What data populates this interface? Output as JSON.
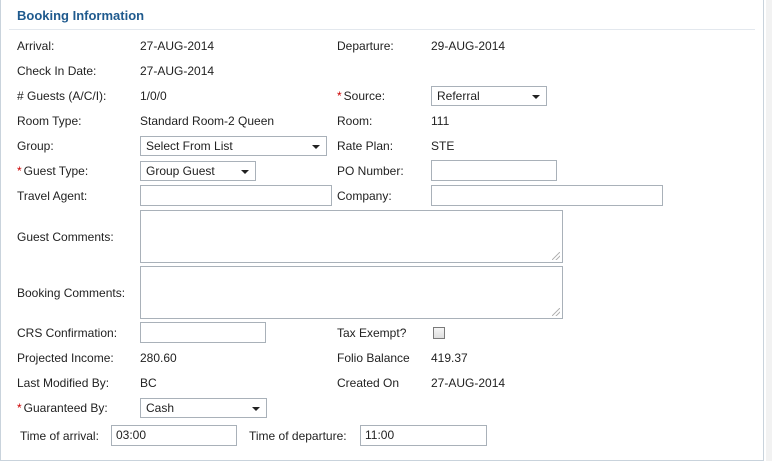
{
  "section": {
    "title": "Booking Information"
  },
  "row_arrival": {
    "arrival_label": "Arrival:",
    "arrival_value": "27-AUG-2014",
    "departure_label": "Departure:",
    "departure_value": "29-AUG-2014"
  },
  "row_checkin": {
    "label": "Check In Date:",
    "value": "27-AUG-2014"
  },
  "row_guests": {
    "label": "# Guests (A/C/I):",
    "value": "1/0/0",
    "source_label": "Source:",
    "source_value": "Referral"
  },
  "row_room": {
    "type_label": "Room Type:",
    "type_value": "Standard Room-2 Queen",
    "room_label": "Room:",
    "room_value": "111"
  },
  "row_group": {
    "label": "Group:",
    "value": "Select From List",
    "rate_label": "Rate Plan:",
    "rate_value": "STE"
  },
  "row_guesttype": {
    "label": "Guest Type:",
    "value": "Group Guest",
    "po_label": "PO Number:",
    "po_value": ""
  },
  "row_agent": {
    "label": "Travel Agent:",
    "value": "",
    "company_label": "Company:",
    "company_value": ""
  },
  "guest_comments": {
    "label": "Guest Comments:",
    "value": ""
  },
  "booking_comments": {
    "label": "Booking Comments:",
    "value": ""
  },
  "row_crs": {
    "label": "CRS Confirmation:",
    "value": "",
    "tax_label": "Tax Exempt?",
    "tax_checked": false
  },
  "row_income": {
    "label": "Projected Income:",
    "value": "280.60",
    "folio_label": "Folio Balance",
    "folio_value": "419.37"
  },
  "row_modified": {
    "label": "Last Modified By:",
    "value": "BC",
    "created_label": "Created On",
    "created_value": "27-AUG-2014"
  },
  "row_guaranteed": {
    "label": "Guaranteed By:",
    "value": "Cash"
  },
  "row_time": {
    "arrival_label": "Time of arrival:",
    "arrival_value": "03:00",
    "departure_label": "Time of departure:",
    "departure_value": "11:00"
  },
  "required_marker": "*",
  "colors": {
    "title": "#1f5a8e",
    "required": "#cc0000",
    "border": "#a9b1b9"
  },
  "icons": {
    "dropdown": "chevron-down-icon",
    "resize": "resize-grip-icon"
  }
}
